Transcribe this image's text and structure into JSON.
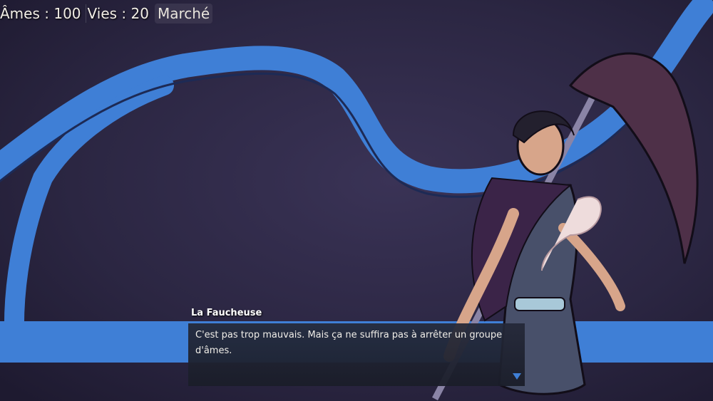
{
  "hud": {
    "souls_label": "Âmes : 100",
    "lives_label": "Vies : 20",
    "market_button": "Marché"
  },
  "dialogue": {
    "speaker": "La Faucheuse",
    "text": "C'est pas trop mauvais. Mais ça ne suffira pas à arrêter un groupe d'âmes.",
    "advance_icon": "triangle-down-icon"
  },
  "colors": {
    "background": "#2a2540",
    "path_blue": "#3f7fd6",
    "text": "#f2eee6"
  }
}
